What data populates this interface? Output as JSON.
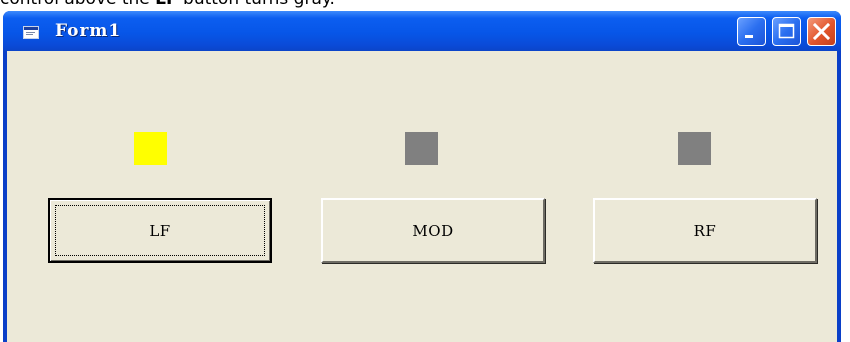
{
  "caption": {
    "before": "control above the ",
    "bold": "LF",
    "after": " button turns gray."
  },
  "window": {
    "title": "Form1",
    "controls": [
      "minimize-icon",
      "maximize-icon",
      "close-icon"
    ]
  },
  "indicators": [
    {
      "name": "lf-indicator",
      "color": "#ffff00"
    },
    {
      "name": "mod-indicator",
      "color": "#808080"
    },
    {
      "name": "rf-indicator",
      "color": "#808080"
    }
  ],
  "buttons": {
    "lf_label": "LF",
    "mod_label": "MOD",
    "rf_label": "RF"
  }
}
